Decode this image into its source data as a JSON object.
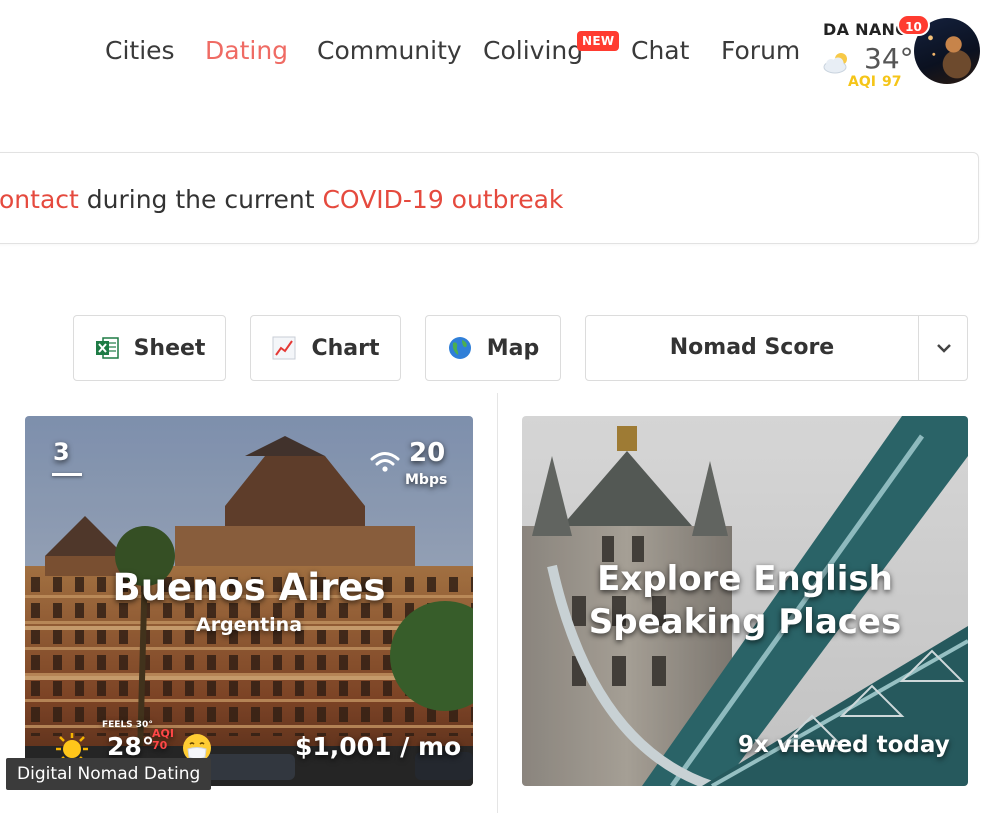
{
  "nav": {
    "items": [
      {
        "label": "Cities"
      },
      {
        "label": "Dating",
        "active": true
      },
      {
        "label": "Community"
      },
      {
        "label": "Coliving"
      },
      {
        "label": "Chat"
      },
      {
        "label": "Forum"
      }
    ],
    "new_badge": "NEW"
  },
  "header_widget": {
    "location": "DA NANG",
    "notifications": "10",
    "weather_icon": "sun-behind-cloud-icon",
    "temperature": "34°",
    "aqi_label": "AQI",
    "aqi_value": "97",
    "aqi_color": "#f5c518"
  },
  "banner": {
    "part1": "ontact",
    "part2": " during the current ",
    "part3": "COVID-19 outbreak",
    "link_color": "#e54a3e"
  },
  "toolbar": {
    "sheet_label": "Sheet",
    "chart_label": "Chart",
    "map_label": "Map",
    "sort_value": "Nomad Score"
  },
  "cards": [
    {
      "rank": "3",
      "internet_speed": "20",
      "internet_unit": "Mbps",
      "city": "Buenos Aires",
      "country": "Argentina",
      "feels_like": "FEELS 30°",
      "temperature": "28°",
      "aqi_mini": "AQI",
      "aqi_mini_value": "70",
      "price": "$1,001 / mo"
    },
    {
      "title": "Explore English Speaking Places",
      "views": "9x viewed today"
    }
  ],
  "tooltip": "Digital Nomad Dating",
  "colors": {
    "accent": "#ef6b64",
    "badge_red": "#ff3b30"
  }
}
